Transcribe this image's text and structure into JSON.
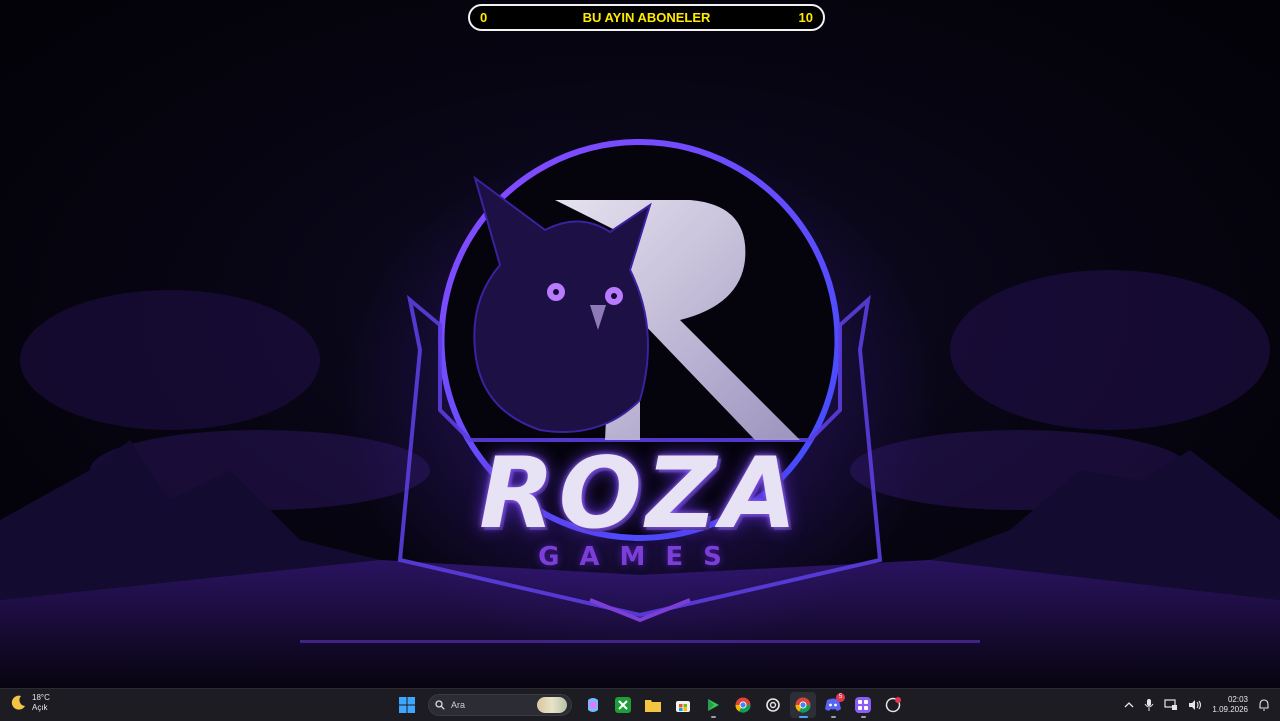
{
  "goal_overlay": {
    "current": "0",
    "title": "BU AYIN ABONELER",
    "target": "10"
  },
  "wallpaper": {
    "brand_name": "ROZA",
    "brand_sub": "GAMES",
    "logo_letter": "R"
  },
  "taskbar": {
    "weather": {
      "temperature": "18°C",
      "condition": "Açık",
      "icon": "moon-icon"
    },
    "search": {
      "placeholder": "Ara"
    },
    "pinned_apps": [
      {
        "name": "start-button",
        "icon": "windows-icon"
      },
      {
        "name": "copilot",
        "icon": "copilot-icon"
      },
      {
        "name": "xbox",
        "icon": "xbox-icon"
      },
      {
        "name": "file-explorer",
        "icon": "folder-icon"
      },
      {
        "name": "microsoft-store",
        "icon": "store-icon"
      },
      {
        "name": "google-play-games",
        "icon": "play-icon"
      },
      {
        "name": "chrome",
        "icon": "chrome-icon"
      },
      {
        "name": "chatgpt",
        "icon": "openai-icon"
      },
      {
        "name": "chrome-active",
        "icon": "chrome-icon"
      },
      {
        "name": "discord",
        "icon": "discord-icon"
      },
      {
        "name": "app-launcher",
        "icon": "apps-icon"
      },
      {
        "name": "recorder",
        "icon": "recorder-icon"
      }
    ],
    "discord_badge": "5",
    "clock": {
      "time": "02:03",
      "date": "1.09.2026"
    }
  },
  "colors": {
    "goal_text": "#ffea00",
    "logo_purple": "#7b3fd8",
    "taskbar_bg": "#1c1c22"
  }
}
